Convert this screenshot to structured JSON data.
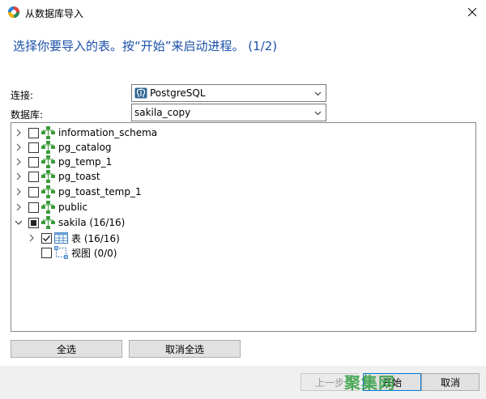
{
  "window": {
    "title": "从数据库导入"
  },
  "heading": "选择你要导入的表。按“开始”来启动进程。 (1/2)",
  "form": {
    "connection_label": "连接:",
    "connection_value": "PostgreSQL",
    "database_label": "数据库:",
    "database_value": "sakila_copy"
  },
  "tree": {
    "items": [
      {
        "label": "information_schema",
        "expanded": false,
        "checked": "none"
      },
      {
        "label": "pg_catalog",
        "expanded": false,
        "checked": "none"
      },
      {
        "label": "pg_temp_1",
        "expanded": false,
        "checked": "none"
      },
      {
        "label": "pg_toast",
        "expanded": false,
        "checked": "none"
      },
      {
        "label": "pg_toast_temp_1",
        "expanded": false,
        "checked": "none"
      },
      {
        "label": "public",
        "expanded": false,
        "checked": "none"
      },
      {
        "label": "sakila (16/16)",
        "expanded": true,
        "checked": "partial"
      },
      {
        "label": "表 (16/16)",
        "expanded": false,
        "checked": "checked"
      },
      {
        "label": "视图 (0/0)",
        "expanded": false,
        "checked": "none"
      }
    ]
  },
  "buttons": {
    "select_all": "全选",
    "deselect_all": "取消全选",
    "previous": "上一步",
    "start": "开始",
    "cancel": "取消"
  },
  "watermark": "聚集网",
  "colors": {
    "heading": "#1a4fa8",
    "schema_icon": "#3a9a3a",
    "selected_border": "#0078d7"
  }
}
